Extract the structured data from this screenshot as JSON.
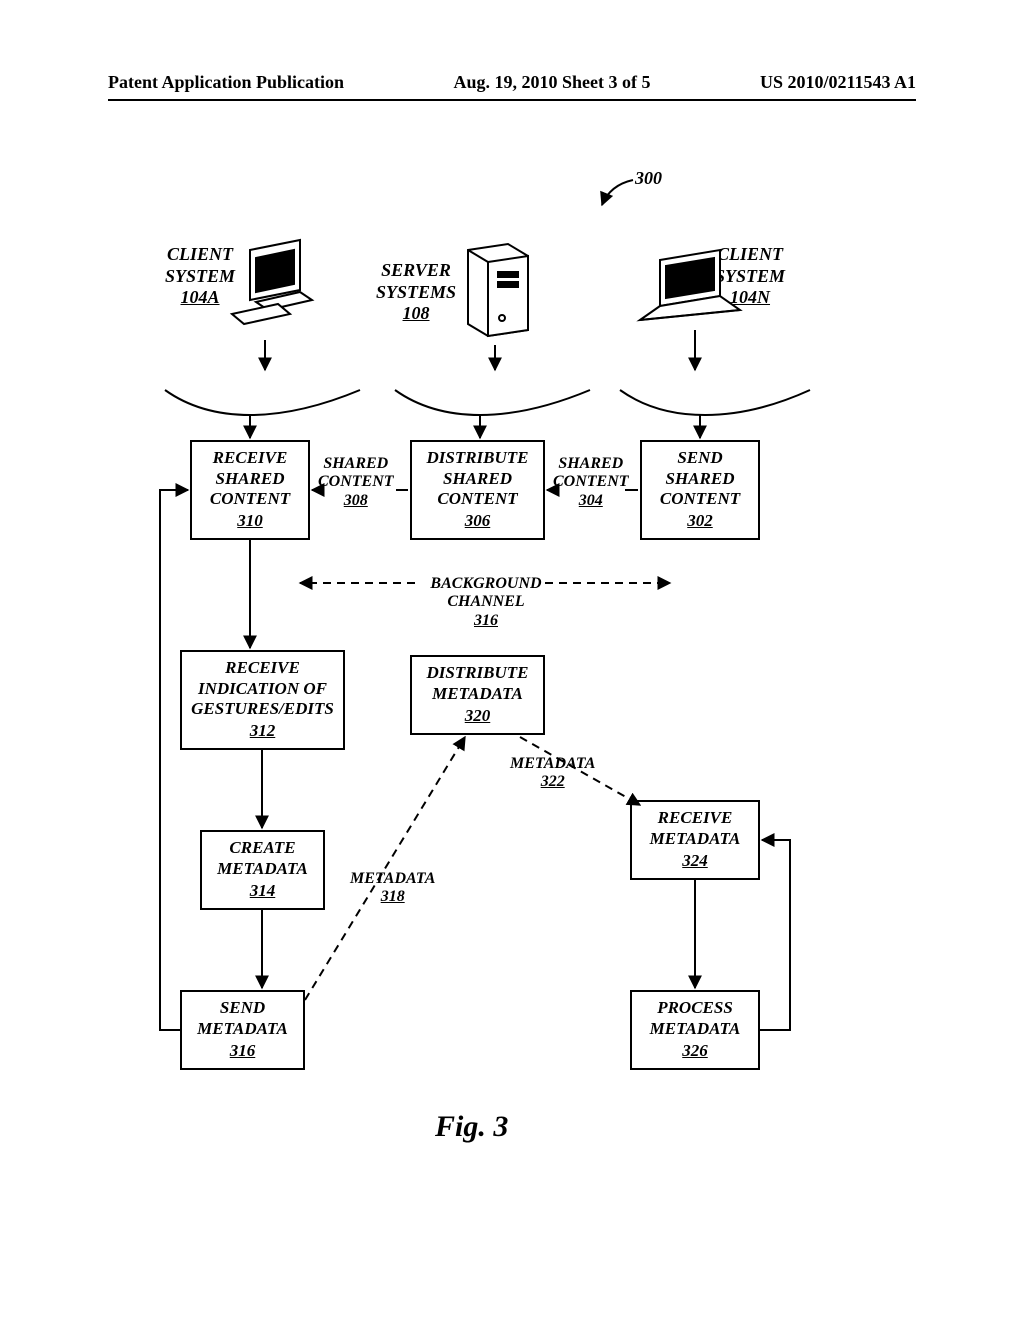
{
  "header": {
    "left": "Patent Application Publication",
    "center": "Aug. 19, 2010  Sheet 3 of 5",
    "right": "US 2010/0211543 A1"
  },
  "figure_number": "300",
  "systems": {
    "clientA": {
      "l1": "CLIENT",
      "l2": "SYSTEM",
      "ref": "104A"
    },
    "server": {
      "l1": "SERVER",
      "l2": "SYSTEMS",
      "ref": "108"
    },
    "clientN": {
      "l1": "CLIENT",
      "l2": "SYSTEM",
      "ref": "104N"
    }
  },
  "boxes": {
    "b310": {
      "l1": "RECEIVE",
      "l2": "SHARED",
      "l3": "CONTENT",
      "ref": "310"
    },
    "b306": {
      "l1": "DISTRIBUTE",
      "l2": "SHARED",
      "l3": "CONTENT",
      "ref": "306"
    },
    "b302": {
      "l1": "SEND",
      "l2": "SHARED",
      "l3": "CONTENT",
      "ref": "302"
    },
    "b312": {
      "l1": "RECEIVE",
      "l2": "INDICATION OF",
      "l3": "GESTURES/EDITS",
      "ref": "312"
    },
    "b320": {
      "l1": "DISTRIBUTE",
      "l2": "METADATA",
      "ref": "320"
    },
    "b324": {
      "l1": "RECEIVE",
      "l2": "METADATA",
      "ref": "324"
    },
    "b314": {
      "l1": "CREATE",
      "l2": "METADATA",
      "ref": "314"
    },
    "b316": {
      "l1": "SEND",
      "l2": "METADATA",
      "ref": "316"
    },
    "b326": {
      "l1": "PROCESS",
      "l2": "METADATA",
      "ref": "326"
    }
  },
  "flowlabels": {
    "sc308": {
      "l1": "SHARED",
      "l2": "CONTENT",
      "ref": "308"
    },
    "sc304": {
      "l1": "SHARED",
      "l2": "CONTENT",
      "ref": "304"
    },
    "bg316": {
      "l1": "BACKGROUND",
      "l2": "CHANNEL",
      "ref": "316"
    },
    "md318": {
      "l1": "METADATA",
      "ref": "318"
    },
    "md322": {
      "l1": "METADATA",
      "ref": "322"
    }
  },
  "figure_caption": "Fig. 3"
}
